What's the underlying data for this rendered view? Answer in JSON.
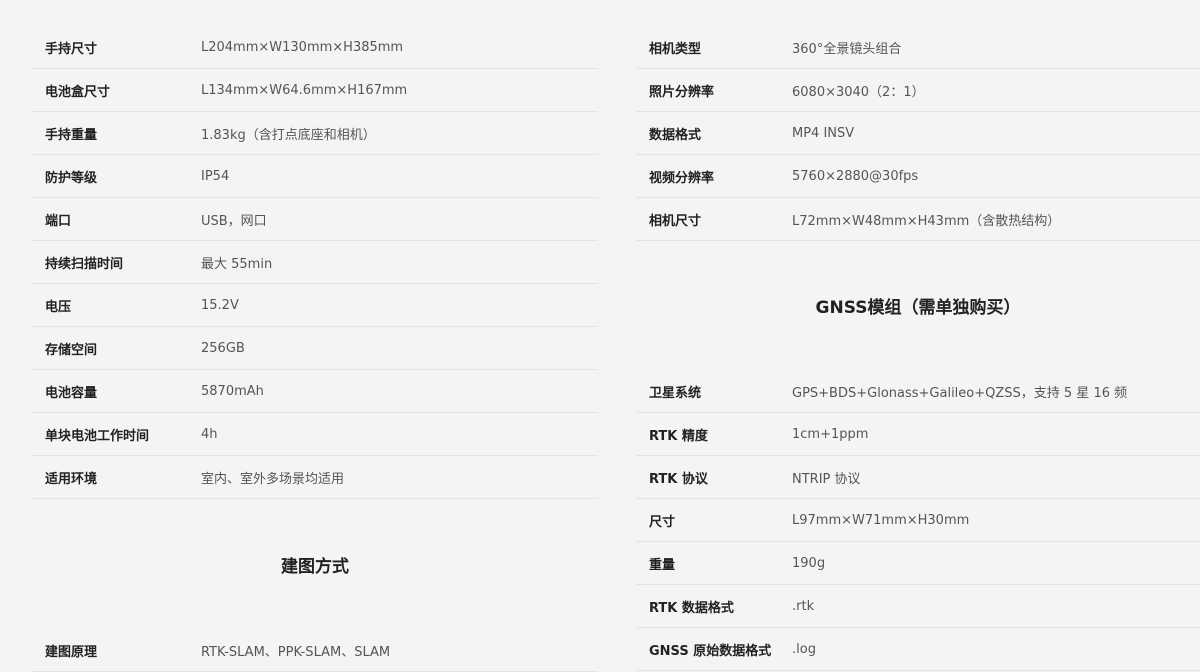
{
  "left": {
    "rows": [
      {
        "label": "手持尺寸",
        "value": "L204mm×W130mm×H385mm"
      },
      {
        "label": "电池盒尺寸",
        "value": "L134mm×W64.6mm×H167mm"
      },
      {
        "label": "手持重量",
        "value": "1.83kg（含打点底座和相机）"
      },
      {
        "label": "防护等级",
        "value": "IP54"
      },
      {
        "label": "端口",
        "value": "USB，网口"
      },
      {
        "label": "持续扫描时间",
        "value": "最大 55min"
      },
      {
        "label": "电压",
        "value": "15.2V"
      },
      {
        "label": "存储空间",
        "value": "256GB"
      },
      {
        "label": "电池容量",
        "value": "5870mAh"
      },
      {
        "label": "单块电池工作时间",
        "value": "4h"
      },
      {
        "label": "适用环境",
        "value": "室内、室外多场景均适用"
      }
    ],
    "section_title": "建图方式",
    "section_rows": [
      {
        "label": "建图原理",
        "value": "RTK-SLAM、PPK-SLAM、SLAM"
      }
    ]
  },
  "right": {
    "rows": [
      {
        "label": "相机类型",
        "value": "360°全景镜头组合"
      },
      {
        "label": "照片分辨率",
        "value": "6080×3040（2：1）"
      },
      {
        "label": "数据格式",
        "value": "MP4 INSV"
      },
      {
        "label": "视频分辨率",
        "value": "5760×2880@30fps"
      },
      {
        "label": "相机尺寸",
        "value": "L72mm×W48mm×H43mm（含散热结构）"
      }
    ],
    "section_title": "GNSS模组（需单独购买）",
    "section_rows": [
      {
        "label": "卫星系统",
        "value": "GPS+BDS+Glonass+Galileo+QZSS，支持 5 星 16 频"
      },
      {
        "label": "RTK 精度",
        "value": "1cm+1ppm"
      },
      {
        "label": "RTK 协议",
        "value": "NTRIP 协议"
      },
      {
        "label": "尺寸",
        "value": "L97mm×W71mm×H30mm"
      },
      {
        "label": "重量",
        "value": "190g"
      },
      {
        "label": "RTK 数据格式",
        "value": ".rtk"
      },
      {
        "label": "GNSS 原始数据格式",
        "value": ".log"
      }
    ]
  }
}
